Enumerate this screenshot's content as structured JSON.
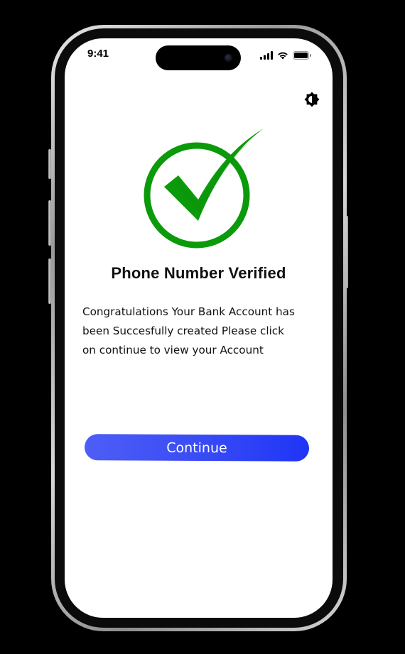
{
  "status_bar": {
    "time": "9:41"
  },
  "verification": {
    "title": "Phone Number Verified",
    "line_1": "Congratulations Your Bank Account has",
    "line_2": "been Succesfully created Please click",
    "line_3": "on continue to view your Account"
  },
  "actions": {
    "continue_label": "Continue"
  },
  "icons": {
    "theme": "brightness-contrast-icon",
    "success": "check-circle-icon",
    "signal": "cellular-signal-icon",
    "wifi": "wifi-icon",
    "battery": "battery-icon"
  },
  "colors": {
    "success_green": "#0a9a0a",
    "button_start": "#4d5ef7",
    "button_end": "#1f35f6",
    "screen_bg": "#ffffff"
  }
}
